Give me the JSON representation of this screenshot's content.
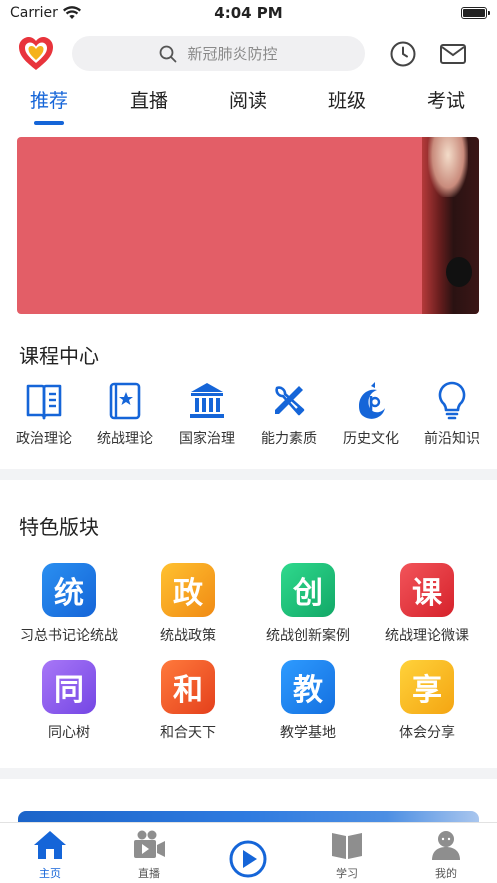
{
  "status_bar": {
    "carrier": "Carrier",
    "time": "4:04 PM"
  },
  "header": {
    "search_placeholder": "新冠肺炎防控",
    "icons": [
      "app-logo",
      "search-icon",
      "history-clock-icon",
      "mail-icon"
    ]
  },
  "tabs": [
    {
      "label": "推荐",
      "active": true
    },
    {
      "label": "直播",
      "active": false
    },
    {
      "label": "阅读",
      "active": false
    },
    {
      "label": "班级",
      "active": false
    },
    {
      "label": "考试",
      "active": false
    }
  ],
  "course_center": {
    "title": "课程中心",
    "items": [
      {
        "label": "政治理论",
        "icon": "open-book-icon"
      },
      {
        "label": "统战理论",
        "icon": "star-book-icon"
      },
      {
        "label": "国家治理",
        "icon": "government-building-icon"
      },
      {
        "label": "能力素质",
        "icon": "tools-icon"
      },
      {
        "label": "历史文化",
        "icon": "history-logo-icon"
      },
      {
        "label": "前沿知识",
        "icon": "lightbulb-icon"
      }
    ]
  },
  "features": {
    "title": "特色版块",
    "items": [
      {
        "glyph": "统",
        "label": "习总书记论统战",
        "color": "#1b7fe8"
      },
      {
        "glyph": "政",
        "label": "统战政策",
        "color": "#f5a623"
      },
      {
        "glyph": "创",
        "label": "统战创新案例",
        "color": "#19c27d"
      },
      {
        "glyph": "课",
        "label": "统战理论微课",
        "color": "#e8383b"
      },
      {
        "glyph": "同",
        "label": "同心树",
        "color": "#8f5bf0"
      },
      {
        "glyph": "和",
        "label": "和合天下",
        "color": "#f0582a"
      },
      {
        "glyph": "教",
        "label": "教学基地",
        "color": "#1a86ee"
      },
      {
        "glyph": "享",
        "label": "体会分享",
        "color": "#f6b81c"
      }
    ]
  },
  "tabbar": {
    "accent": "#1565d8",
    "items": [
      {
        "label": "主页",
        "icon": "home-icon",
        "active": true
      },
      {
        "label": "直播",
        "icon": "video-camera-icon",
        "active": false
      },
      {
        "label": "",
        "icon": "play-circle-icon",
        "active": false
      },
      {
        "label": "学习",
        "icon": "book-icon",
        "active": false
      },
      {
        "label": "我的",
        "icon": "user-icon",
        "active": false
      }
    ]
  }
}
